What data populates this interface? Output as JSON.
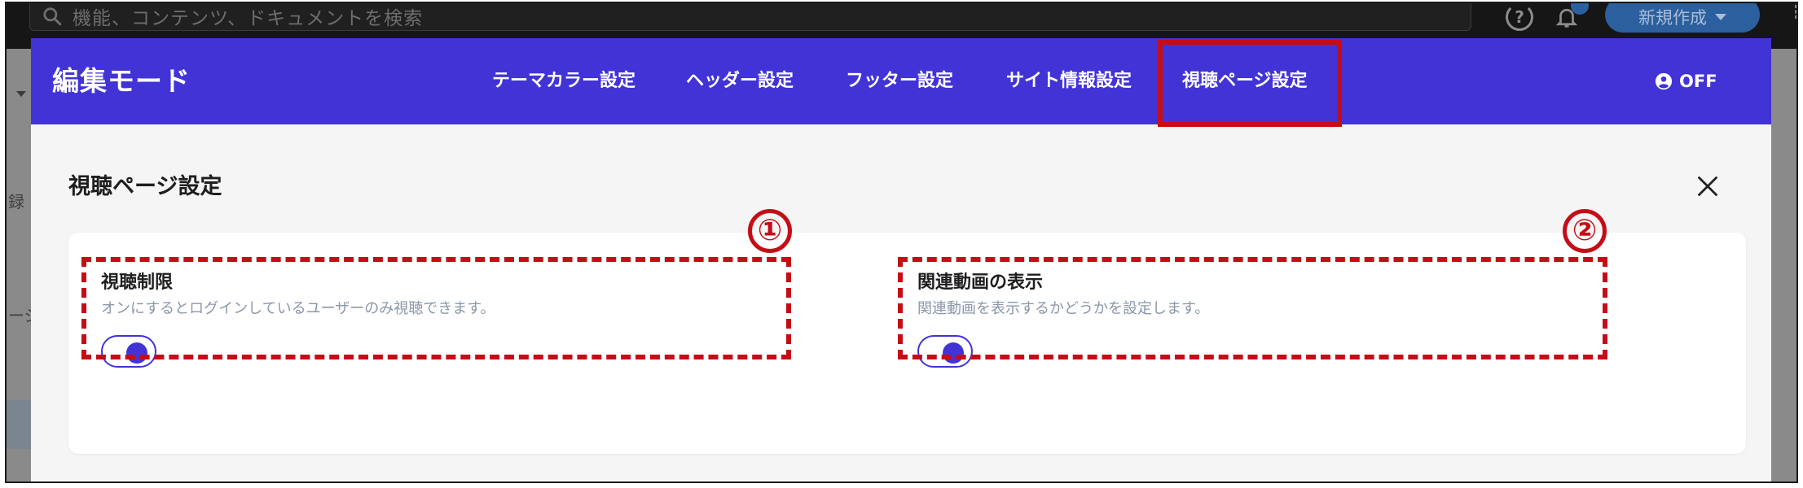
{
  "background": {
    "search_placeholder": "機能、コンテンツ、ドキュメントを検索",
    "help_glyph": "?",
    "new_button_label": "新規作成",
    "more_glyph": "⋮",
    "side_fragment_a": "録",
    "side_fragment_b": "ージ"
  },
  "modal": {
    "title": "編集モード",
    "tabs": [
      {
        "label": "テーマカラー設定"
      },
      {
        "label": "ヘッダー設定"
      },
      {
        "label": "フッター設定"
      },
      {
        "label": "サイト情報設定"
      },
      {
        "label": "視聴ページ設定",
        "highlighted": true
      }
    ],
    "off_label": "OFF",
    "panel_title": "視聴ページ設定",
    "settings": [
      {
        "marker": "①",
        "label": "視聴制限",
        "description": "オンにするとログインしているユーザーのみ視聴できます。",
        "enabled": true
      },
      {
        "marker": "②",
        "label": "関連動画の表示",
        "description": "関連動画を表示するかどうかを設定します。",
        "enabled": true
      }
    ]
  },
  "colors": {
    "accent": "#4233d6",
    "annotation_red": "#c50d17",
    "description_text": "#8b97aa"
  }
}
